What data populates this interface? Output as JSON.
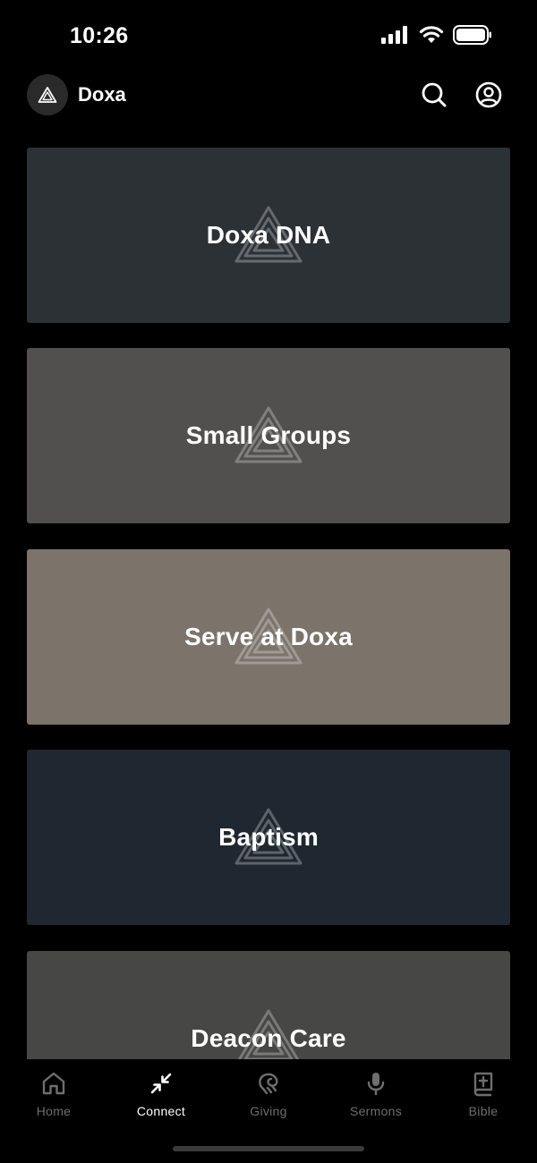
{
  "status_bar": {
    "time": "10:26"
  },
  "header": {
    "title": "Doxa",
    "logo_icon": "triangle-logo-icon",
    "search_icon": "search-icon",
    "profile_icon": "user-circle-icon"
  },
  "cards": [
    {
      "label": "Doxa DNA",
      "color": "#2c3136"
    },
    {
      "label": "Small Groups",
      "color": "#51504e"
    },
    {
      "label": "Serve at Doxa",
      "color": "#7c736b"
    },
    {
      "label": "Baptism",
      "color": "#1f2731"
    },
    {
      "label": "Deacon Care",
      "color": "#474746"
    }
  ],
  "tab_bar": {
    "tabs": [
      {
        "label": "Home",
        "icon": "home-icon"
      },
      {
        "label": "Connect",
        "icon": "connect-arrows-icon"
      },
      {
        "label": "Giving",
        "icon": "giving-icon"
      },
      {
        "label": "Sermons",
        "icon": "microphone-icon"
      },
      {
        "label": "Bible",
        "icon": "bible-icon"
      }
    ],
    "active": "Connect"
  }
}
